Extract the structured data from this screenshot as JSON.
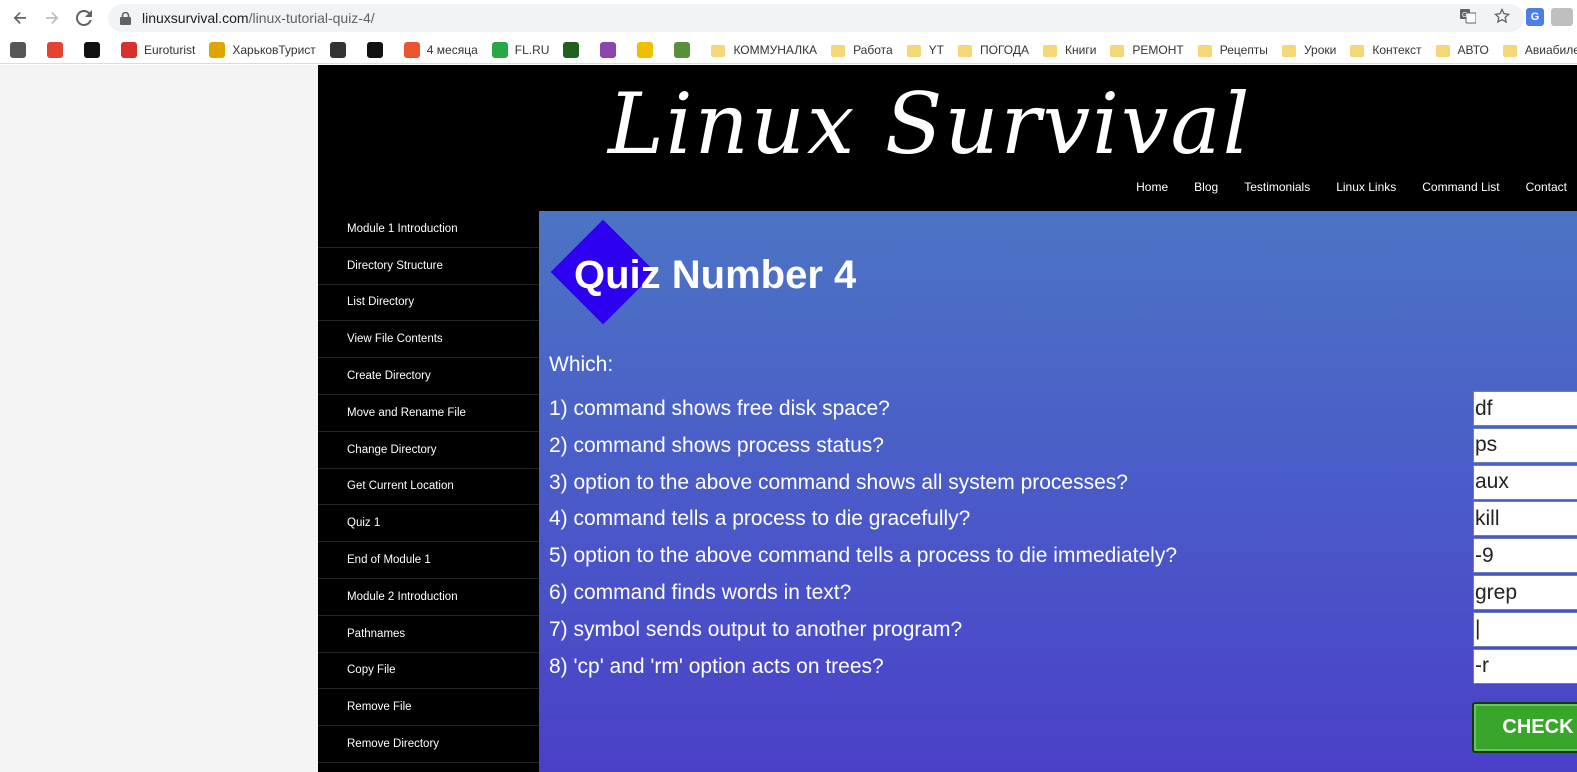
{
  "browser": {
    "url_host": "linuxsurvival.com",
    "url_path": "/linux-tutorial-quiz-4/",
    "icons": [
      "back-icon",
      "forward-icon",
      "reload-icon",
      "lock-icon",
      "translate-icon",
      "star-icon"
    ]
  },
  "bookmarks": [
    {
      "label": "",
      "icon": "cat-icon",
      "color": "#555555"
    },
    {
      "label": "",
      "icon": "todoist-icon",
      "color": "#e44332"
    },
    {
      "label": "",
      "icon": "notion-icon",
      "color": "#111111"
    },
    {
      "label": "Euroturist",
      "icon": "euroturist-icon",
      "color": "#d9302b"
    },
    {
      "label": "ХарьковТурист",
      "icon": "hiker-icon",
      "color": "#e0a500"
    },
    {
      "label": "",
      "icon": "bike-icon",
      "color": "#333333"
    },
    {
      "label": "",
      "icon": "mountain-icon",
      "color": "#111111"
    },
    {
      "label": "4 месяца",
      "icon": "l-icon",
      "color": "#e8552e"
    },
    {
      "label": "FL.RU",
      "icon": "fl-icon",
      "color": "#28a745"
    },
    {
      "label": "",
      "icon": "shield-icon",
      "color": "#1f5f1f"
    },
    {
      "label": "",
      "icon": "flower-icon",
      "color": "#8e44ad"
    },
    {
      "label": "",
      "icon": "note-icon",
      "color": "#f0c000"
    },
    {
      "label": "",
      "icon": "tree-icon",
      "color": "#5a8f3a"
    },
    {
      "label": "КОММУНАЛКА",
      "icon": "folder-icon"
    },
    {
      "label": "Работа",
      "icon": "folder-icon"
    },
    {
      "label": "YT",
      "icon": "folder-icon"
    },
    {
      "label": "ПОГОДА",
      "icon": "folder-icon"
    },
    {
      "label": "Книги",
      "icon": "folder-icon"
    },
    {
      "label": "РЕМОНТ",
      "icon": "folder-icon"
    },
    {
      "label": "Рецепты",
      "icon": "folder-icon"
    },
    {
      "label": "Уроки",
      "icon": "folder-icon"
    },
    {
      "label": "Контекст",
      "icon": "folder-icon"
    },
    {
      "label": "АВТО",
      "icon": "folder-icon"
    },
    {
      "label": "Авиабиле",
      "icon": "folder-icon"
    }
  ],
  "site": {
    "logo": "Linux Survival",
    "nav": [
      "Home",
      "Blog",
      "Testimonials",
      "Linux Links",
      "Command List",
      "Contact"
    ]
  },
  "sidebar": {
    "items": [
      "Module 1 Introduction",
      "Directory Structure",
      "List Directory",
      "View File Contents",
      "Create Directory",
      "Move and Rename File",
      "Change Directory",
      "Get Current Location",
      "Quiz 1",
      "End of Module 1",
      "Module 2 Introduction",
      "Pathnames",
      "Copy File",
      "Remove File",
      "Remove Directory"
    ]
  },
  "quiz": {
    "title": "Quiz Number 4",
    "intro": "Which:",
    "questions": [
      {
        "text": "1) command shows free disk space?",
        "answer": "df"
      },
      {
        "text": "2) command shows process status?",
        "answer": "ps"
      },
      {
        "text": "3) option to the above command shows all system processes?",
        "answer": "aux"
      },
      {
        "text": "4) command tells a process to die gracefully?",
        "answer": "kill"
      },
      {
        "text": "5) option to the above command tells a process to die immediately?",
        "answer": "-9"
      },
      {
        "text": "6) command finds words in text?",
        "answer": "grep"
      },
      {
        "text": "7) symbol sends output to another program?",
        "answer": "|"
      },
      {
        "text": "8) 'cp' and 'rm' option acts on trees?",
        "answer": "-r"
      }
    ],
    "check_button": "CHECK ANSWERS",
    "check_color": "#2fd62f"
  }
}
